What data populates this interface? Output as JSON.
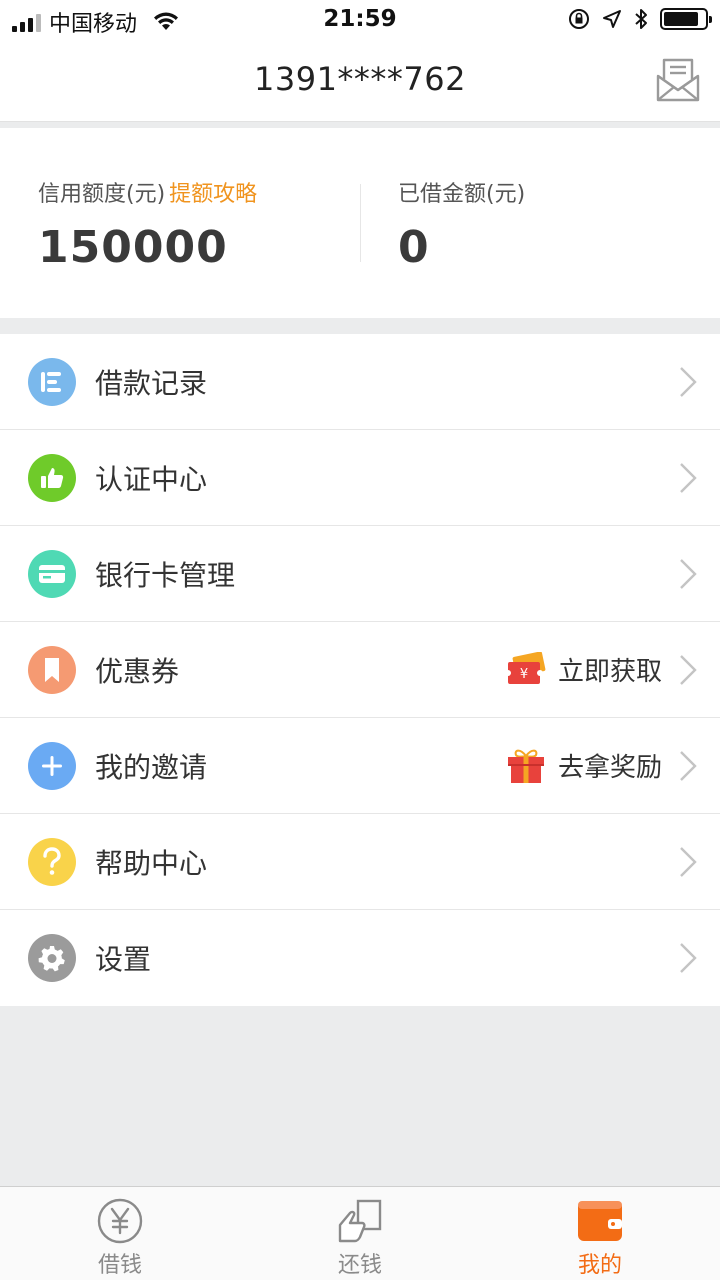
{
  "status_bar": {
    "carrier": "中国移动",
    "time": "21:59"
  },
  "header": {
    "title": "1391****762",
    "message_icon": "envelope-icon"
  },
  "credit": {
    "limit_label": "信用额度(元)",
    "limit_link": "提额攻略",
    "limit_value": "150000",
    "borrowed_label": "已借金额(元)",
    "borrowed_value": "0"
  },
  "menu": {
    "items": [
      {
        "label": "借款记录",
        "icon": "list-icon",
        "color": "#7ab8ec"
      },
      {
        "label": "认证中心",
        "icon": "thumbs-up-icon",
        "color": "#6fcb2a"
      },
      {
        "label": "银行卡管理",
        "icon": "card-icon",
        "color": "#4fd9b4"
      },
      {
        "label": "优惠券",
        "icon": "bookmark-icon",
        "color": "#f59a72",
        "extra": "立即获取",
        "extra_icon": "coupon-ticket-icon"
      },
      {
        "label": "我的邀请",
        "icon": "plus-icon",
        "color": "#6aaaf3",
        "extra": "去拿奖励",
        "extra_icon": "gift-icon"
      },
      {
        "label": "帮助中心",
        "icon": "question-icon",
        "color": "#f9d34a"
      },
      {
        "label": "设置",
        "icon": "gear-icon",
        "color": "#9b9b9b"
      }
    ]
  },
  "tabbar": {
    "tabs": [
      {
        "label": "借钱",
        "icon": "yen-coin-icon",
        "active": false
      },
      {
        "label": "还钱",
        "icon": "repay-hand-icon",
        "active": false
      },
      {
        "label": "我的",
        "icon": "wallet-icon",
        "active": true
      }
    ]
  },
  "colors": {
    "accent": "#f36c15",
    "link": "#f0941f",
    "background": "#ebeced"
  }
}
